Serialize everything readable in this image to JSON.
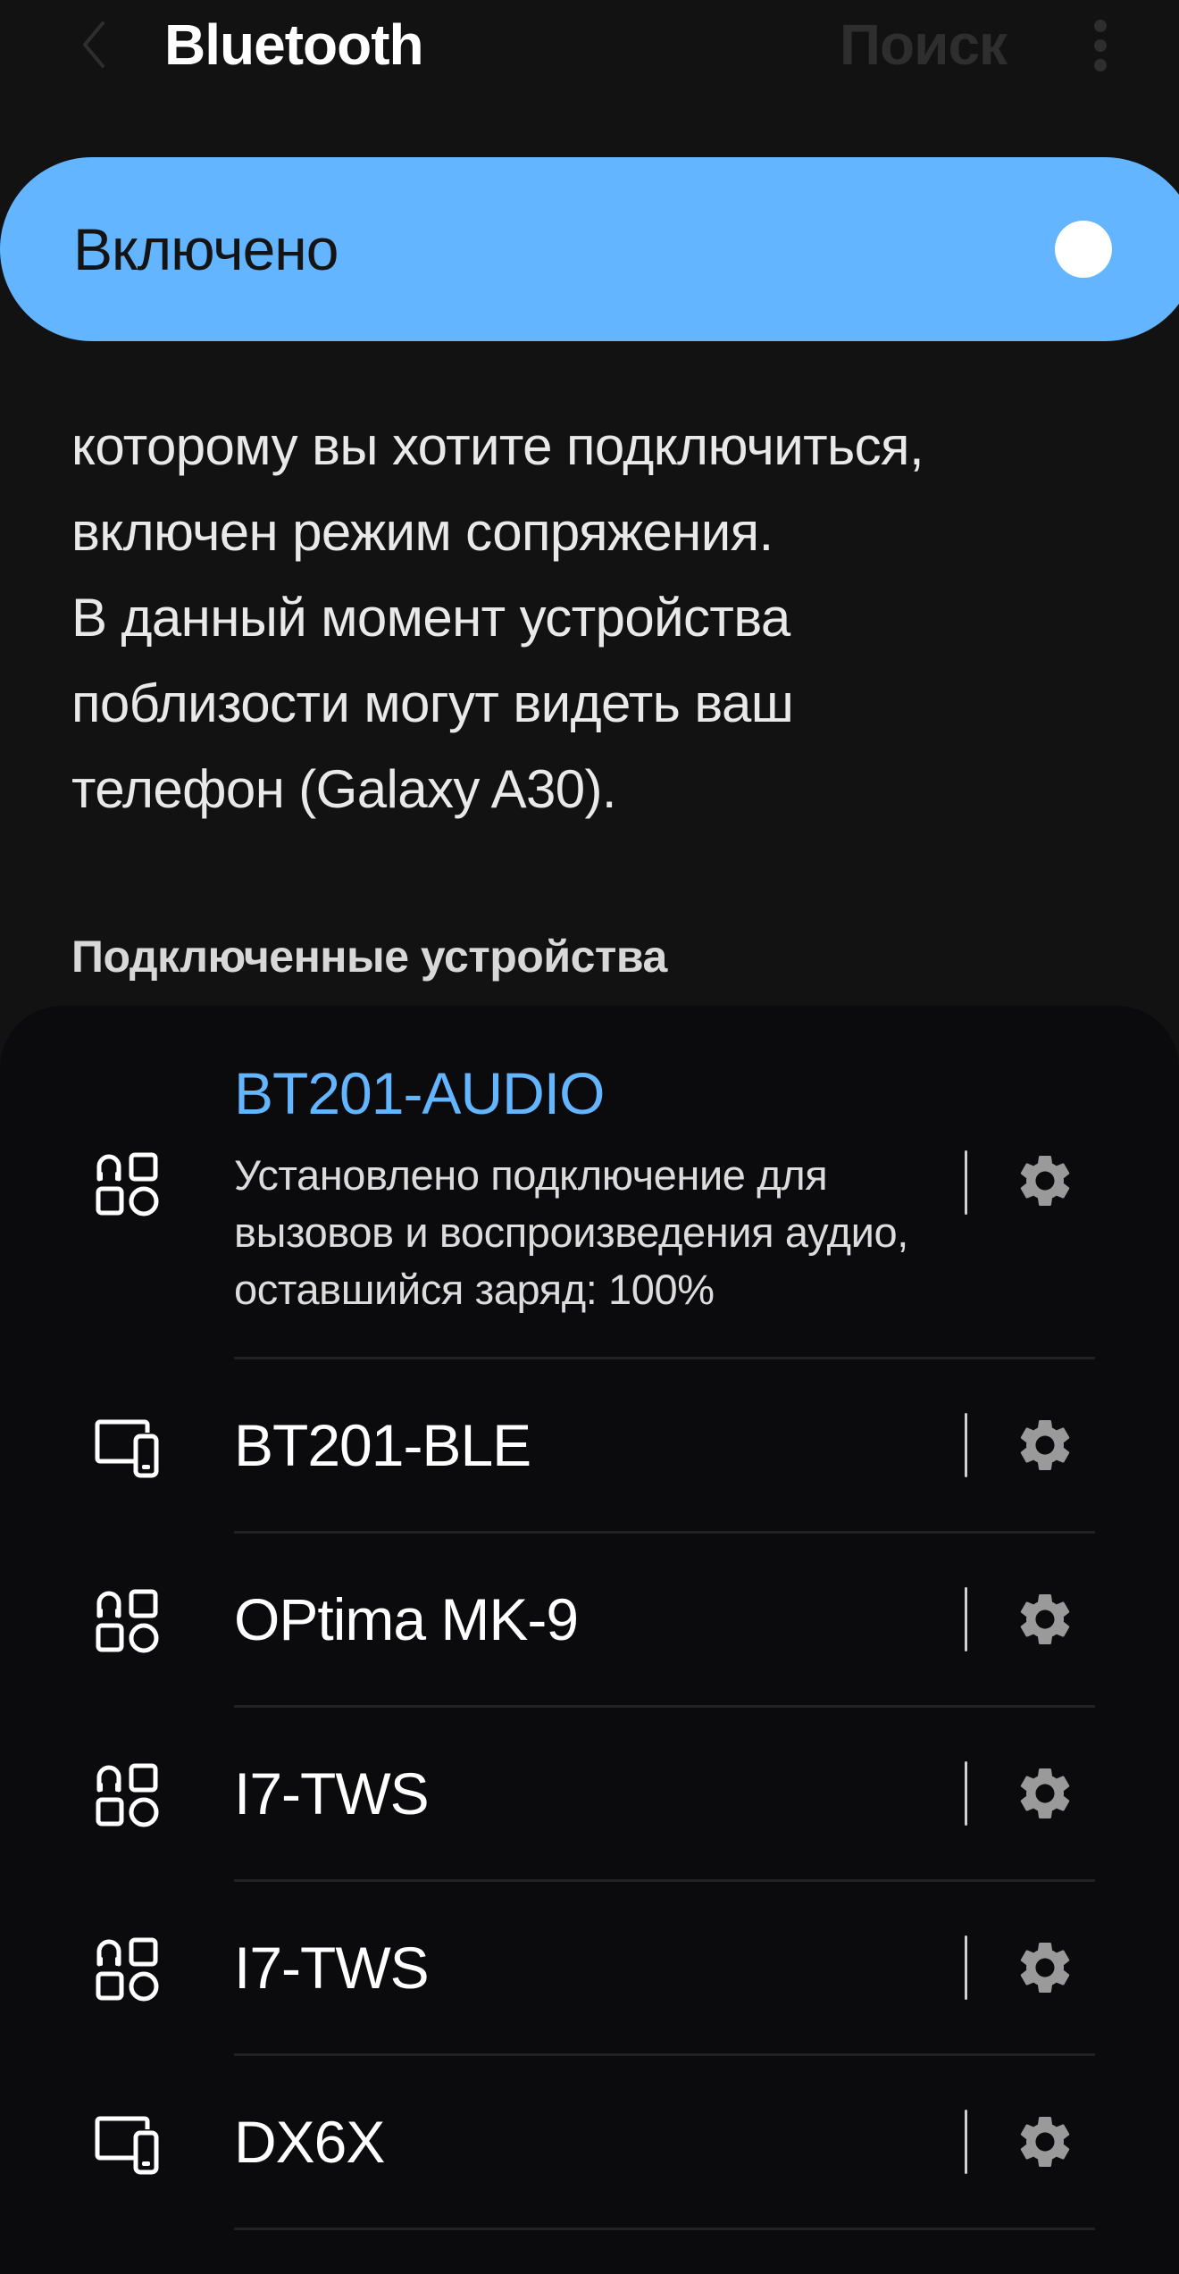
{
  "appbar": {
    "title": "Bluetooth",
    "search_label": "Поиск",
    "back_icon": "chevron-left-icon",
    "more_icon": "more-vert-icon"
  },
  "toggle": {
    "label": "Включено",
    "state": "on",
    "accent_color": "#64b5ff"
  },
  "description": {
    "lines": [
      "которому вы хотите подключиться,",
      "включен режим сопряжения.",
      "В данный момент устройства",
      "поблизости могут видеть ваш",
      "телефон (Galaxy A30)."
    ]
  },
  "section": {
    "title": "Подключенные устройства"
  },
  "devices": [
    {
      "name": "BT201-AUDIO",
      "connected": true,
      "icon": "audio-device-icon",
      "status": "Установлено подключение для вызовов и воспроизведения аудио, оставшийся заряд: 100%"
    },
    {
      "name": "BT201-BLE",
      "connected": false,
      "icon": "devices-icon"
    },
    {
      "name": "OPtima MK-9",
      "connected": false,
      "icon": "audio-device-icon"
    },
    {
      "name": "I7-TWS",
      "connected": false,
      "icon": "audio-device-icon"
    },
    {
      "name": "I7-TWS",
      "connected": false,
      "icon": "audio-device-icon"
    },
    {
      "name": "DX6X",
      "connected": false,
      "icon": "devices-icon"
    }
  ]
}
